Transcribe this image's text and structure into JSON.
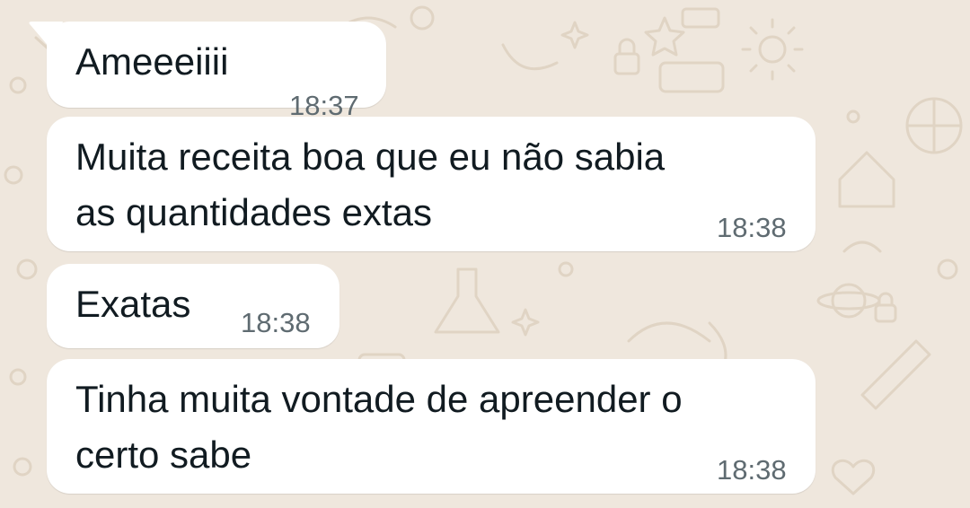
{
  "chat": {
    "messages": [
      {
        "text": "Ameeeiiii",
        "time": "18:37"
      },
      {
        "text": "Muita receita boa que eu não sabia\nas quantidades extas",
        "time": "18:38"
      },
      {
        "text": "Exatas",
        "time": "18:38"
      },
      {
        "text": "Tinha muita vontade de apreender o\ncerto sabe",
        "time": "18:38"
      }
    ]
  },
  "colors": {
    "background": "#efe7dd",
    "bubble": "#ffffff",
    "text": "#111b21",
    "timestamp": "#5f6b71",
    "doodle": "#e3d8ca"
  }
}
